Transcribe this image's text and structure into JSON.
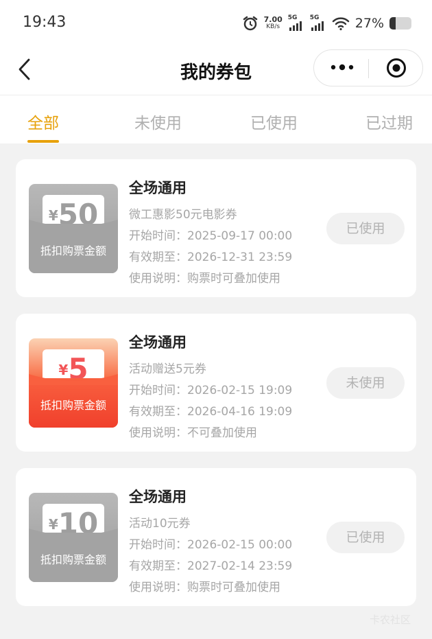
{
  "status_bar": {
    "time": "19:43",
    "net_speed_value": "7.00",
    "net_speed_unit": "KB/s",
    "sim1_tag": "5G",
    "sim2_tag": "5G",
    "battery_percent": "27%",
    "battery_level": 0.27,
    "icons": [
      "alarm-icon",
      "signal-icon",
      "wifi-icon",
      "battery-icon"
    ]
  },
  "nav": {
    "title": "我的券包",
    "icons": [
      "back-icon",
      "more-icon",
      "target-icon"
    ]
  },
  "tabs": [
    {
      "label": "全部",
      "active": true
    },
    {
      "label": "未使用",
      "active": false
    },
    {
      "label": "已使用",
      "active": false
    },
    {
      "label": "已过期",
      "active": false
    }
  ],
  "coupons": [
    {
      "style": "gray",
      "currency": "¥",
      "amount": "50",
      "deduct_label": "抵扣购票金额",
      "title": "全场通用",
      "name": "微工惠影50元电影券",
      "start_time": "开始时间：2025-09-17 00:00",
      "valid_until": "有效期至：2026-12-31 23:59",
      "usage_note": "使用说明：购票时可叠加使用",
      "status": "已使用"
    },
    {
      "style": "red",
      "currency": "¥",
      "amount": "5",
      "deduct_label": "抵扣购票金额",
      "title": "全场通用",
      "name": "活动赠送5元券",
      "start_time": "开始时间：2026-02-15 19:09",
      "valid_until": "有效期至：2026-04-16 19:09",
      "usage_note": "使用说明：不可叠加使用",
      "status": "未使用"
    },
    {
      "style": "gray",
      "currency": "¥",
      "amount": "10",
      "deduct_label": "抵扣购票金额",
      "title": "全场通用",
      "name": "活动10元券",
      "start_time": "开始时间：2026-02-15 00:00",
      "valid_until": "有效期至：2027-02-14 23:59",
      "usage_note": "使用说明：购票时可叠加使用",
      "status": "已使用"
    }
  ],
  "watermark": "卡农社区",
  "colors": {
    "accent": "#e7a10b",
    "coupon_gray": "#a3a3a3",
    "coupon_red": "#f0402c",
    "status_button_bg": "#f1f1f1"
  }
}
